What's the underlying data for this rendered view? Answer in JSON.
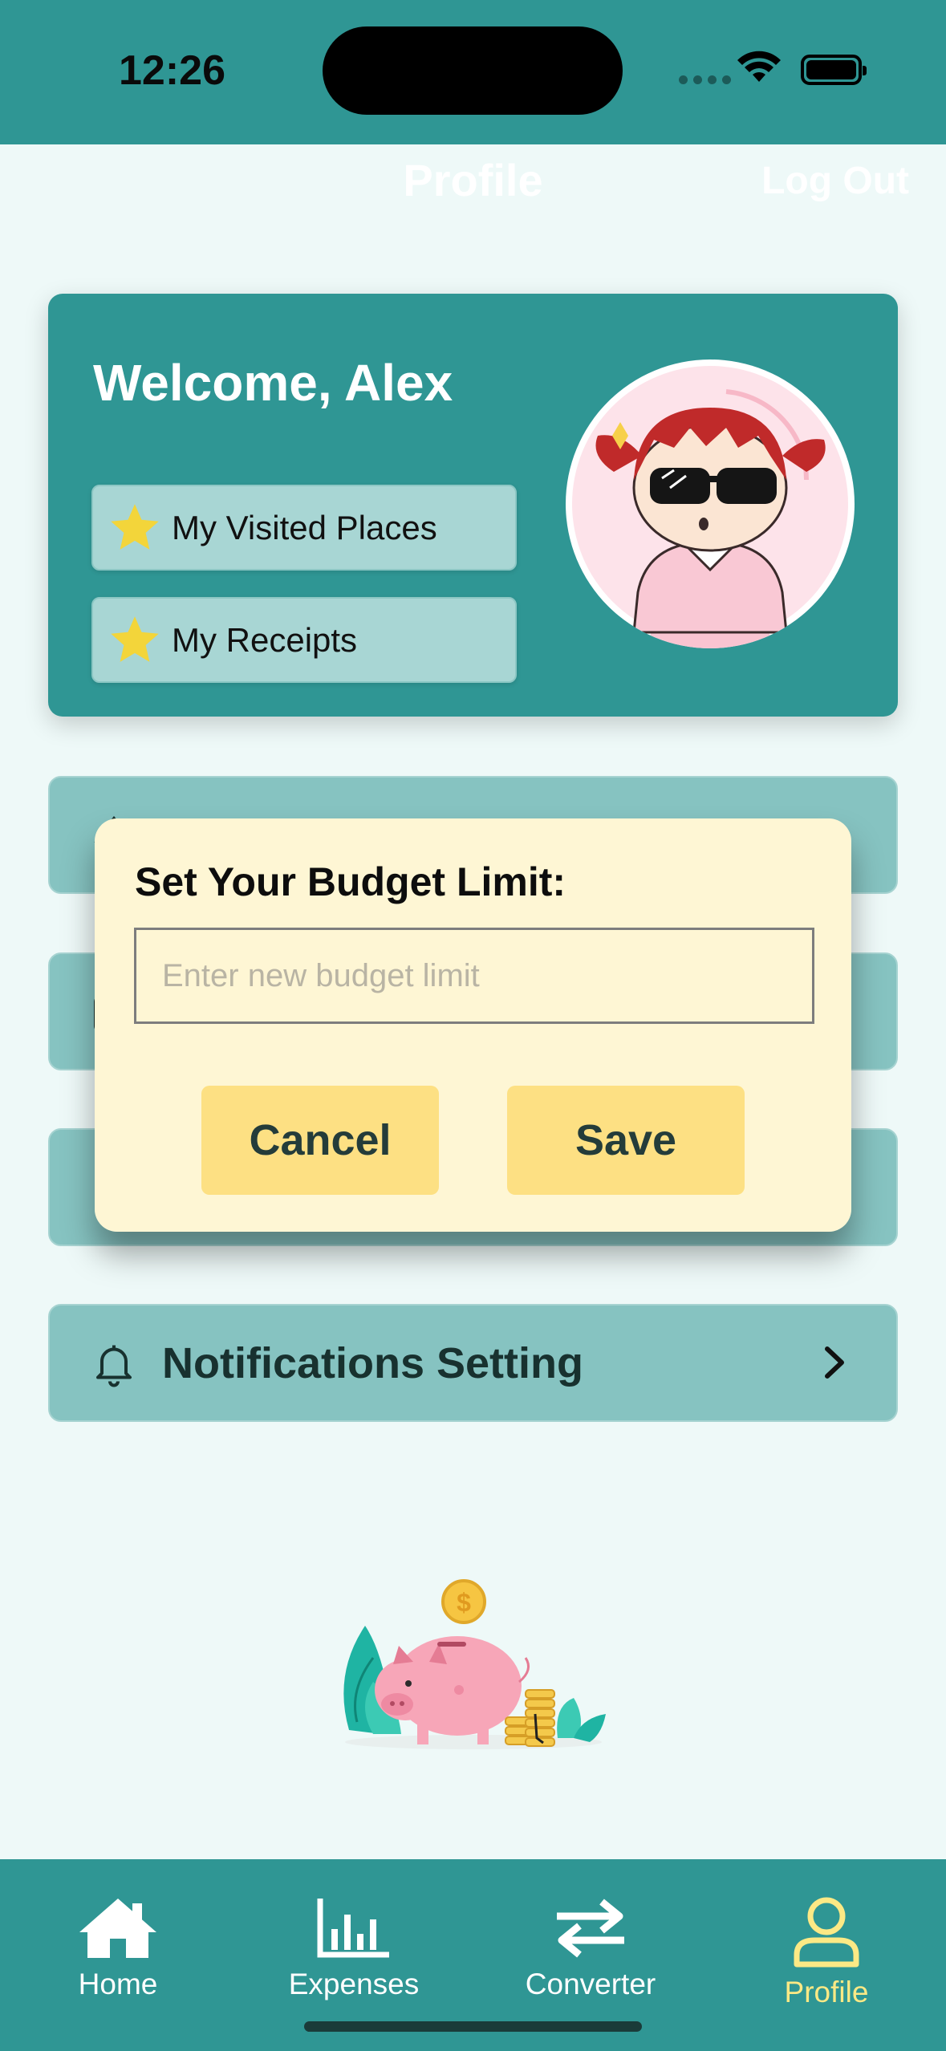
{
  "status_bar": {
    "time": "12:26"
  },
  "nav": {
    "title": "Profile",
    "logout_label": "Log Out"
  },
  "welcome": {
    "greeting": "Welcome, Alex",
    "buttons": [
      {
        "label": "My Visited Places",
        "icon": "star-icon"
      },
      {
        "label": "My Receipts",
        "icon": "star-icon"
      }
    ]
  },
  "menu": {
    "notifications_label": "Notifications Setting"
  },
  "dialog": {
    "title": "Set Your Budget Limit:",
    "input_placeholder": "Enter new budget limit",
    "input_value": "",
    "cancel_label": "Cancel",
    "save_label": "Save"
  },
  "tabbar": {
    "tabs": [
      {
        "label": "Home",
        "icon": "home-icon",
        "active": false
      },
      {
        "label": "Expenses",
        "icon": "bar-chart-icon",
        "active": false
      },
      {
        "label": "Converter",
        "icon": "swap-arrows-icon",
        "active": false
      },
      {
        "label": "Profile",
        "icon": "person-icon",
        "active": true
      }
    ]
  },
  "colors": {
    "primary": "#2f9694",
    "row": "#86c3c1",
    "dialog_bg": "#fef6d4",
    "button_yellow": "#fde083",
    "active_tab": "#fce985"
  }
}
